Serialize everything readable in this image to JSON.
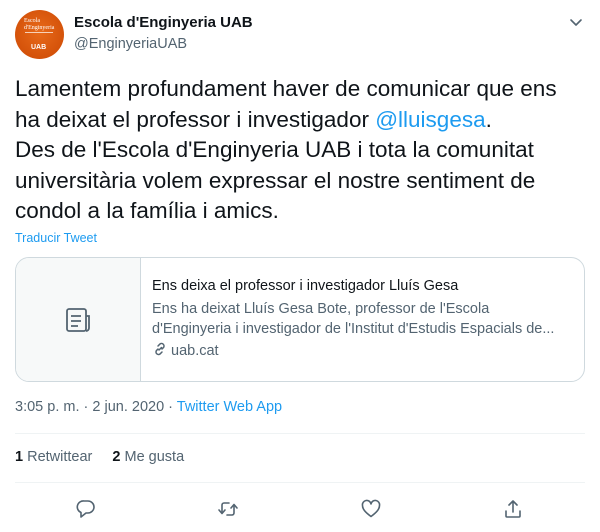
{
  "account": {
    "name": "Escola d'Enginyeria UAB",
    "handle": "@EnginyeriaUAB",
    "avatar_text_top": "Escola d'Enginyeria",
    "avatar_text_bottom": "UAB"
  },
  "tweet": {
    "line1": "Lamentem profundament haver de comunicar que ens",
    "line2_prefix": "ha deixat el professor i investigador ",
    "mention": "@lluisgesa",
    "line2_suffix": ".",
    "line3": "Des de l'Escola d'Enginyeria UAB i tota la comunitat",
    "line4": "universitària volem expressar el nostre sentiment de",
    "line5": "condol a la família i amics."
  },
  "translate_label": "Traducir Tweet",
  "card": {
    "title": "Ens deixa el professor i investigador Lluís Gesa",
    "desc_line1": "Ens ha deixat Lluís Gesa Bote, professor de l'Escola",
    "desc_line2": "d'Enginyeria i investigador de l'Institut d'Estudis Espacials de...",
    "domain": "uab.cat"
  },
  "meta": {
    "time": "3:05 p. m.",
    "separator": " · ",
    "date": "2 jun. 2020",
    "source": "Twitter Web App"
  },
  "stats": {
    "retweets_count": "1",
    "retweets_label": "Retwittear",
    "likes_count": "2",
    "likes_label": "Me gusta"
  },
  "colors": {
    "accent": "#1d9bf0",
    "text": "#0f1419",
    "secondary": "#536471",
    "border": "#cfd9de",
    "avatar": "#d4520a"
  },
  "icons": {
    "more": "chevron-down-icon",
    "card_thumb": "document-icon",
    "domain": "link-icon",
    "reply": "reply-icon",
    "retweet": "retweet-icon",
    "like": "heart-icon",
    "share": "share-icon"
  }
}
